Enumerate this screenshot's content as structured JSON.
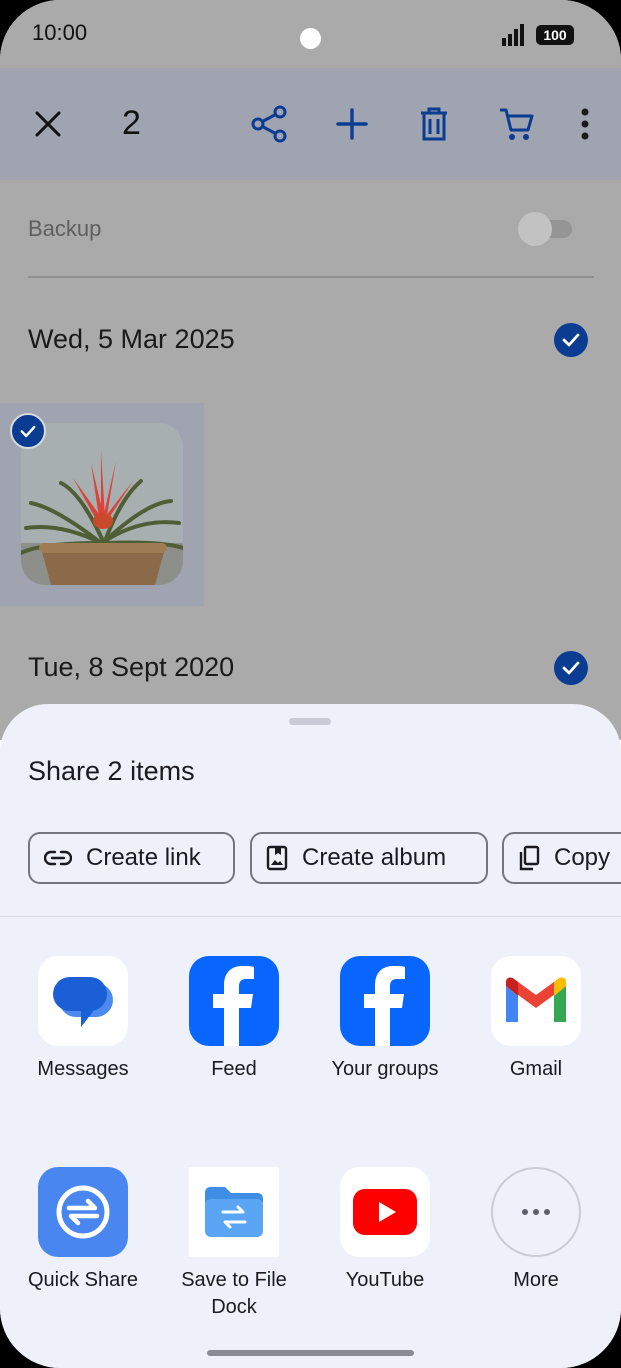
{
  "status_bar": {
    "time": "10:00",
    "battery": "100"
  },
  "selection_bar": {
    "count": "2",
    "icons": [
      "close-icon",
      "share-icon",
      "add-icon",
      "delete-icon",
      "cart-icon",
      "more-vert-icon"
    ]
  },
  "backup": {
    "label": "Backup",
    "enabled": false
  },
  "groups": [
    {
      "date": "Wed, 5 Mar 2025",
      "selected": true
    },
    {
      "date": "Tue, 8 Sept 2020",
      "selected": true
    }
  ],
  "share_sheet": {
    "title": "Share 2 items",
    "chips": [
      {
        "label": "Create link",
        "icon": "link-icon"
      },
      {
        "label": "Create album",
        "icon": "album-icon"
      },
      {
        "label": "Copy",
        "icon": "copy-icon"
      }
    ],
    "apps": [
      {
        "label": "Messages",
        "icon": "messages-icon"
      },
      {
        "label": "Feed",
        "icon": "facebook-icon"
      },
      {
        "label": "Your groups",
        "icon": "facebook-icon"
      },
      {
        "label": "Gmail",
        "icon": "gmail-icon"
      },
      {
        "label": "Quick Share",
        "icon": "quick-share-icon"
      },
      {
        "label": "Save to File\nDock",
        "icon": "file-dock-icon"
      },
      {
        "label": "YouTube",
        "icon": "youtube-icon"
      },
      {
        "label": "More",
        "icon": "more-horiz-icon"
      }
    ]
  },
  "colors": {
    "accent": "#0a3d91",
    "sheet_background": "#eef1fa",
    "facebook": "#0866ff",
    "youtube": "#ff0000"
  }
}
